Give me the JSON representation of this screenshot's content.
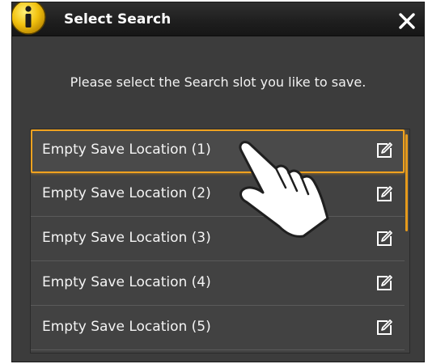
{
  "dialog": {
    "title": "Select Search",
    "prompt": "Please select the Search slot you like to save.",
    "icons": {
      "title": "info-icon",
      "close": "close-icon",
      "row_action": "edit-icon",
      "pointer": "hand-pointer-icon"
    },
    "accent_color": "#f0a21f",
    "items": [
      {
        "label": "Empty Save Location (1)",
        "selected": true
      },
      {
        "label": "Empty Save Location (2)",
        "selected": false
      },
      {
        "label": "Empty Save Location (3)",
        "selected": false
      },
      {
        "label": "Empty Save Location (4)",
        "selected": false
      },
      {
        "label": "Empty Save Location (5)",
        "selected": false
      }
    ]
  }
}
